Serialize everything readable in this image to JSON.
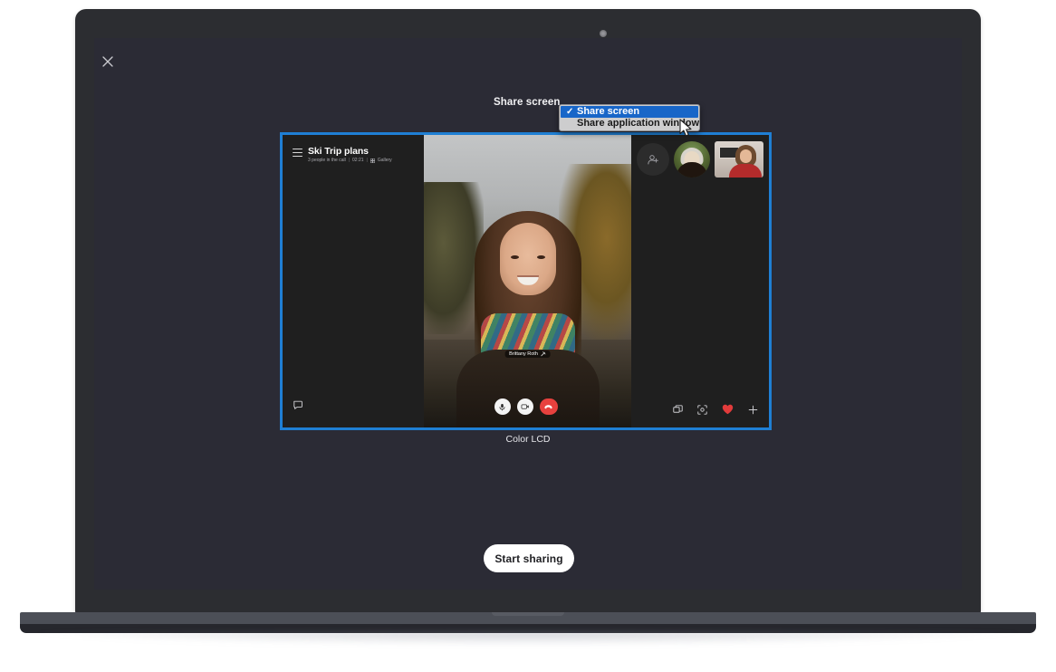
{
  "dialog": {
    "close_icon": "close-icon",
    "share_label": "Share screen",
    "monitor_label": "Color LCD",
    "start_sharing_label": "Start sharing"
  },
  "source_select": {
    "selected_value": "Share screen",
    "checkmark": "✓",
    "options": [
      {
        "label": "Share screen",
        "selected": true
      },
      {
        "label": "Share application window",
        "selected": false
      }
    ]
  },
  "preview": {
    "meeting_title": "Ski Trip plans",
    "participants_text": "3 people in the call",
    "separator": "|",
    "elapsed_time": "02:21",
    "layout_mode": "Gallery",
    "speaker_name": "Brittany Roth",
    "menu_icon": "hamburger-menu-icon",
    "chat_icon": "chat-bubble-icon",
    "add_people_icon": "add-person-icon",
    "controls": {
      "mic": "microphone-icon",
      "camera": "video-camera-icon",
      "hangup": "end-call-icon",
      "share": "share-screen-icon",
      "focus": "focus-frame-icon",
      "reaction": "heart-icon",
      "more": "plus-icon"
    }
  },
  "device": {
    "webcam": "webcam-dot"
  },
  "colors": {
    "screen_bg": "#2b2b35",
    "lid": "#2c2d31",
    "selection_blue": "#1f7fd4",
    "menu_highlight": "#1866c8",
    "hangup_red": "#e8413e",
    "heart_red": "#e23b3b",
    "button_white": "#ffffff"
  }
}
